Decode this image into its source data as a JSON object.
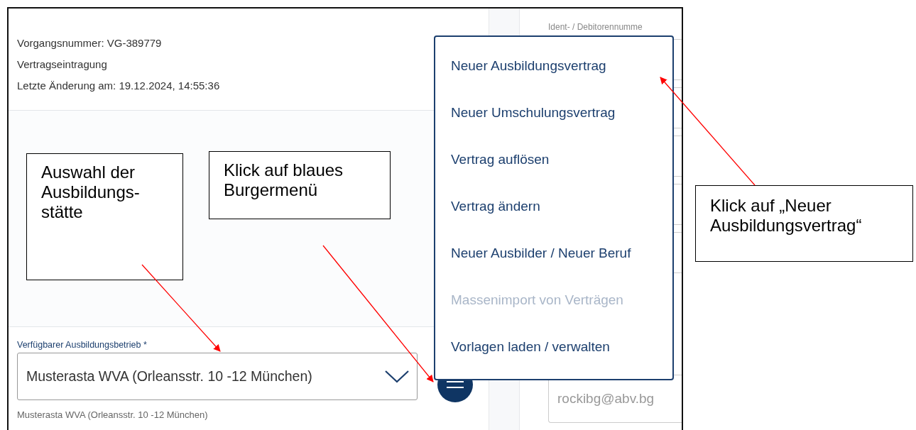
{
  "header": {
    "lines": [
      "Vorgangsnummer: VG-389779",
      "Vertragseintragung",
      "Letzte Änderung am: 19.12.2024, 14:55:36"
    ]
  },
  "company_field": {
    "label": "Verfügbarer Ausbildungsbetrieb *",
    "value": "Musterasta WVA (Orleansstr. 10 -12 München)",
    "helper": "Musterasta WVA (Orleansstr. 10 -12 München)"
  },
  "right_column": {
    "field_label": "Ident- / Debitorennumme",
    "email_value": "rockibg@abv.bg"
  },
  "menu": {
    "items": [
      {
        "label": "Neuer Ausbildungsvertrag",
        "disabled": false
      },
      {
        "label": "Neuer Umschulungsvertrag",
        "disabled": false
      },
      {
        "label": "Vertrag auflösen",
        "disabled": false
      },
      {
        "label": "Vertrag ändern",
        "disabled": false
      },
      {
        "label": "Neuer Ausbilder / Neuer Beruf",
        "disabled": false
      },
      {
        "label": "Massenimport von Verträgen",
        "disabled": true
      },
      {
        "label": "Vorlagen laden / verwalten",
        "disabled": false
      }
    ]
  },
  "annotations": [
    {
      "lines": [
        "Auswahl der",
        "Ausbildungs-",
        "stätte"
      ]
    },
    {
      "lines": [
        "Klick auf blaues",
        "Burgermenü"
      ]
    },
    {
      "lines": [
        "Klick auf „Neuer",
        "Ausbildungsvertrag“"
      ]
    }
  ]
}
